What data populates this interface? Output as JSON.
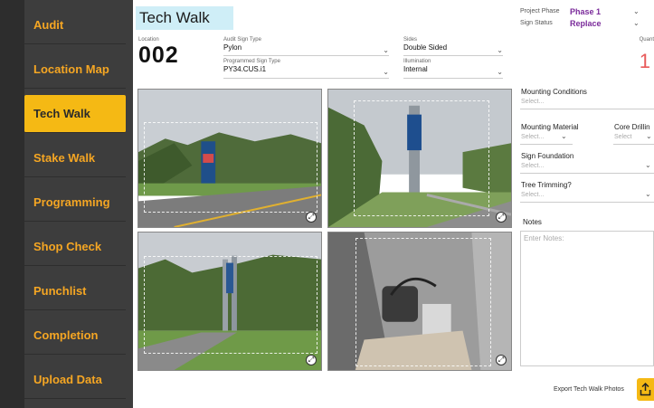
{
  "sidebar": {
    "items": [
      {
        "label": "Audit"
      },
      {
        "label": "Location Map"
      },
      {
        "label": "Tech Walk"
      },
      {
        "label": "Stake Walk"
      },
      {
        "label": "Programming"
      },
      {
        "label": "Shop Check"
      },
      {
        "label": "Punchlist"
      },
      {
        "label": "Completion"
      },
      {
        "label": "Upload Data"
      }
    ],
    "active": "Tech Walk"
  },
  "header": {
    "title": "Tech Walk",
    "project_phase_label": "Project Phase",
    "project_phase_value": "Phase 1",
    "sign_status_label": "Sign Status",
    "sign_status_value": "Replace"
  },
  "location": {
    "label": "Location",
    "value": "002"
  },
  "fields": {
    "audit_sign_type_label": "Audit Sign Type",
    "audit_sign_type_value": "Pylon",
    "programmed_sign_type_label": "Programmed Sign Type",
    "programmed_sign_type_value": "PY34.CUS.i1",
    "sides_label": "Sides",
    "sides_value": "Double Sided",
    "illumination_label": "Illumination",
    "illumination_value": "Internal",
    "quantity_label": "Quant",
    "quantity_value": "1"
  },
  "right_panel": {
    "mounting_conditions_label": "Mounting Conditions",
    "mounting_conditions_placeholder": "Select...",
    "mounting_material_label": "Mounting Material",
    "mounting_material_placeholder": "Select...",
    "core_drilling_label": "Core Drillin",
    "core_drilling_placeholder": "Select",
    "sign_foundation_label": "Sign Foundation",
    "sign_foundation_placeholder": "Select...",
    "tree_trimming_label": "Tree Trimming?",
    "tree_trimming_placeholder": "Select...",
    "notes_label": "Notes",
    "notes_placeholder": "Enter Notes:"
  },
  "footer": {
    "export_label": "Export Tech Walk Photos"
  },
  "colors": {
    "sidebar_bg": "#3d3d3d",
    "accent": "#f5b914",
    "title_bg": "#cfeef7",
    "phase_value": "#7a2a9a",
    "quantity": "#e85a5a"
  }
}
